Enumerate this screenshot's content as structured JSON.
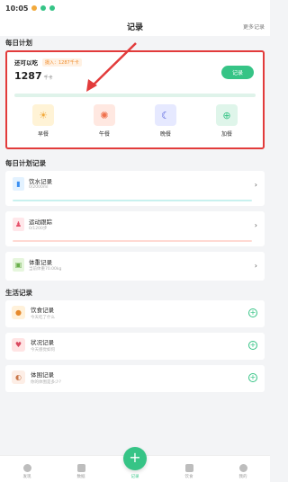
{
  "statusbar": {
    "time": "10:05"
  },
  "header": {
    "title": "记录",
    "more": "更多记录"
  },
  "daily_plan": {
    "section_title": "每日计划",
    "label": "还可以吃",
    "intake_badge": "摄入：1287千卡",
    "kcal": "1287",
    "kcal_unit": "千卡",
    "record_button": "记录",
    "progress_fraction": 0.0,
    "meals": [
      {
        "name": "早餐",
        "icon": "sunrise-icon",
        "bg": "#fff3d6",
        "color": "#f2a93b"
      },
      {
        "name": "午餐",
        "icon": "sun-icon",
        "bg": "#ffe8e1",
        "color": "#f0714c"
      },
      {
        "name": "晚餐",
        "icon": "moon-icon",
        "bg": "#e6e9ff",
        "color": "#4a57d9"
      },
      {
        "name": "加餐",
        "icon": "plus-circle-icon",
        "bg": "#dff5ea",
        "color": "#36c486"
      }
    ]
  },
  "plan_records": {
    "section_title": "每日计划记录",
    "items": [
      {
        "title": "饮水记录",
        "sub": "0/2000ml",
        "icon": "water-cup-icon",
        "bar": "#c8f1ef"
      },
      {
        "title": "运动跟踪",
        "sub": "0/1200步",
        "icon": "exercise-icon",
        "bar": "#ffd9d2"
      },
      {
        "title": "体重记录",
        "sub": "当前体重70.00kg",
        "icon": "weight-scale-icon",
        "bar": ""
      }
    ]
  },
  "life_records": {
    "section_title": "生活记录",
    "items": [
      {
        "title": "饮食记录",
        "sub": "今天吃了什么",
        "icon": "food-icon"
      },
      {
        "title": "状况记录",
        "sub": "今天感觉如何",
        "icon": "status-icon"
      },
      {
        "title": "体围记录",
        "sub": "你的体围是多少?",
        "icon": "body-measure-icon"
      }
    ]
  },
  "tabbar": {
    "tabs": [
      "发现",
      "数据",
      "记录",
      "饮食",
      "我的"
    ]
  },
  "colors": {
    "accent": "#36c486",
    "highlight": "#e23b3b"
  }
}
